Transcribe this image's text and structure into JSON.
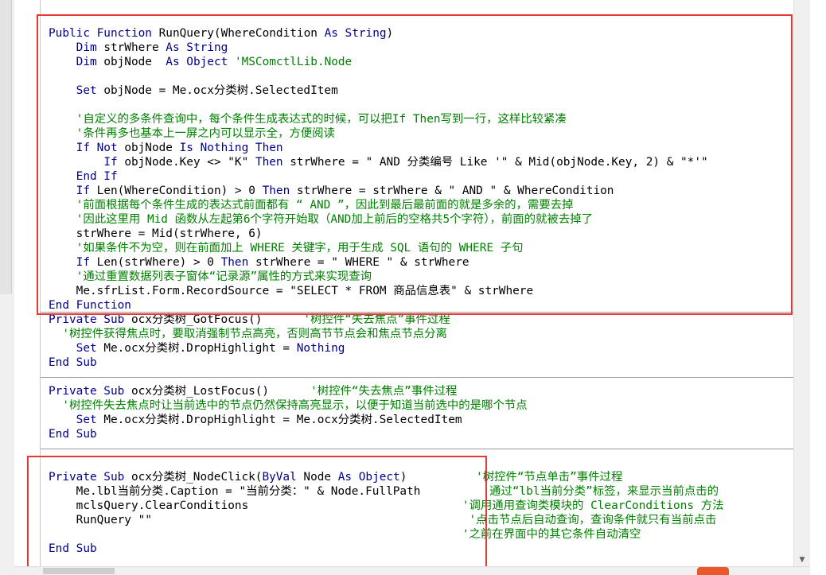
{
  "colors": {
    "keyword": "#00008b",
    "comment": "#008000",
    "plain": "#000000",
    "highlight_box": "#e53935",
    "separator": "#9a9a9a"
  },
  "icons": {
    "scroll_down": "triangle-down",
    "taskbar": "orange-app-icon"
  },
  "procedures": [
    {
      "name": "RunQuery",
      "lines": [
        [
          {
            "t": "k",
            "v": "Public Function "
          },
          {
            "t": "p",
            "v": "RunQuery(WhereCondition "
          },
          {
            "t": "k",
            "v": "As String"
          },
          {
            "t": "p",
            "v": ")"
          }
        ],
        [
          {
            "t": "p",
            "v": "    "
          },
          {
            "t": "k",
            "v": "Dim "
          },
          {
            "t": "p",
            "v": "strWhere "
          },
          {
            "t": "k",
            "v": "As String"
          }
        ],
        [
          {
            "t": "p",
            "v": "    "
          },
          {
            "t": "k",
            "v": "Dim "
          },
          {
            "t": "p",
            "v": "objNode  "
          },
          {
            "t": "k",
            "v": "As Object "
          },
          {
            "t": "c",
            "v": "'MSComctlLib.Node"
          }
        ],
        [],
        [
          {
            "t": "p",
            "v": "    "
          },
          {
            "t": "k",
            "v": "Set "
          },
          {
            "t": "p",
            "v": "objNode = Me.ocx分类树.SelectedItem"
          }
        ],
        [],
        [
          {
            "t": "p",
            "v": "    "
          },
          {
            "t": "c",
            "v": "'自定义的多条件查询中，每个条件生成表达式的时候，可以把If Then写到一行，这样比较紧凑"
          }
        ],
        [
          {
            "t": "p",
            "v": "    "
          },
          {
            "t": "c",
            "v": "'条件再多也基本上一屏之内可以显示全，方便阅读"
          }
        ],
        [
          {
            "t": "p",
            "v": "    "
          },
          {
            "t": "k",
            "v": "If Not "
          },
          {
            "t": "p",
            "v": "objNode "
          },
          {
            "t": "k",
            "v": "Is Nothing Then"
          }
        ],
        [
          {
            "t": "p",
            "v": "        "
          },
          {
            "t": "k",
            "v": "If "
          },
          {
            "t": "p",
            "v": "objNode.Key <> \"K\" "
          },
          {
            "t": "k",
            "v": "Then "
          },
          {
            "t": "p",
            "v": "strWhere = \" AND 分类编号 Like '\" & Mid(objNode.Key, 2) & \"*'\""
          }
        ],
        [
          {
            "t": "p",
            "v": "    "
          },
          {
            "t": "k",
            "v": "End If"
          }
        ],
        [
          {
            "t": "p",
            "v": "    "
          },
          {
            "t": "k",
            "v": "If "
          },
          {
            "t": "p",
            "v": "Len(WhereCondition) > 0 "
          },
          {
            "t": "k",
            "v": "Then "
          },
          {
            "t": "p",
            "v": "strWhere = strWhere & \" AND \" & WhereCondition"
          }
        ],
        [
          {
            "t": "p",
            "v": "    "
          },
          {
            "t": "c",
            "v": "'前面根据每个条件生成的表达式前面都有 “ AND ”，因此到最后最前面的就是多余的，需要去掉"
          }
        ],
        [
          {
            "t": "p",
            "v": "    "
          },
          {
            "t": "c",
            "v": "'因此这里用 Mid 函数从左起第6个字符开始取（AND加上前后的空格共5个字符），前面的就被去掉了"
          }
        ],
        [
          {
            "t": "p",
            "v": "    strWhere = Mid(strWhere, 6)"
          }
        ],
        [
          {
            "t": "p",
            "v": "    "
          },
          {
            "t": "c",
            "v": "'如果条件不为空，则在前面加上 WHERE 关键字，用于生成 SQL 语句的 WHERE 子句"
          }
        ],
        [
          {
            "t": "p",
            "v": "    "
          },
          {
            "t": "k",
            "v": "If "
          },
          {
            "t": "p",
            "v": "Len(strWhere) > 0 "
          },
          {
            "t": "k",
            "v": "Then "
          },
          {
            "t": "p",
            "v": "strWhere = \" WHERE \" & strWhere"
          }
        ],
        [
          {
            "t": "p",
            "v": "    "
          },
          {
            "t": "c",
            "v": "'通过重置数据列表子窗体“记录源”属性的方式来实现查询"
          }
        ],
        [
          {
            "t": "p",
            "v": "    Me.sfrList.Form.RecordSource = \"SELECT * FROM 商品信息表\" & strWhere"
          }
        ],
        [
          {
            "t": "k",
            "v": "End Function"
          }
        ]
      ]
    },
    {
      "name": "ocx分类树_GotFocus",
      "lines": [
        [
          {
            "t": "k",
            "v": "Private Sub "
          },
          {
            "t": "p",
            "v": "ocx分类树_GotFocus()      "
          },
          {
            "t": "c",
            "v": "'树控件“失去焦点”事件过程"
          }
        ],
        [
          {
            "t": "p",
            "v": "  "
          },
          {
            "t": "c",
            "v": "'树控件获得焦点时，要取消强制节点高亮，否则高节节点会和焦点节点分离"
          }
        ],
        [
          {
            "t": "p",
            "v": "    "
          },
          {
            "t": "k",
            "v": "Set "
          },
          {
            "t": "p",
            "v": "Me.ocx分类树.DropHighlight = "
          },
          {
            "t": "k",
            "v": "Nothing"
          }
        ],
        [
          {
            "t": "k",
            "v": "End Sub"
          }
        ]
      ]
    },
    {
      "name": "ocx分类树_LostFocus",
      "lines": [
        [
          {
            "t": "k",
            "v": "Private Sub "
          },
          {
            "t": "p",
            "v": "ocx分类树_LostFocus()      "
          },
          {
            "t": "c",
            "v": "'树控件“失去焦点”事件过程"
          }
        ],
        [
          {
            "t": "p",
            "v": "  "
          },
          {
            "t": "c",
            "v": "'树控件失去焦点时让当前选中的节点仍然保持高亮显示，以便于知道当前选中的是哪个节点"
          }
        ],
        [
          {
            "t": "p",
            "v": "    "
          },
          {
            "t": "k",
            "v": "Set "
          },
          {
            "t": "p",
            "v": "Me.ocx分类树.DropHighlight = Me.ocx分类树.SelectedItem"
          }
        ],
        [
          {
            "t": "k",
            "v": "End Sub"
          }
        ]
      ]
    },
    {
      "name": "ocx分类树_NodeClick",
      "lines": [
        [
          {
            "t": "k",
            "v": "Private Sub "
          },
          {
            "t": "p",
            "v": "ocx分类树_NodeClick("
          },
          {
            "t": "k",
            "v": "ByVal "
          },
          {
            "t": "p",
            "v": "Node "
          },
          {
            "t": "k",
            "v": "As Object"
          },
          {
            "t": "p",
            "v": ")          "
          },
          {
            "t": "c",
            "v": "'树控件“节点单击”事件过程"
          }
        ],
        [
          {
            "t": "p",
            "v": "    Me.lbl当前分类.Caption = \"当前分类：\" & Node.FullPath         "
          },
          {
            "t": "c",
            "v": "'通过“lbl当前分类”标签，来显示当前点击的"
          }
        ],
        [
          {
            "t": "p",
            "v": "    mclsQuery.ClearConditions                               "
          },
          {
            "t": "c",
            "v": "'调用通用查询类模块的 ClearConditions 方法"
          }
        ],
        [
          {
            "t": "p",
            "v": "    RunQuery \"\"                                              "
          },
          {
            "t": "c",
            "v": "'点击节点后自动查询，查询条件就只有当前点击"
          }
        ],
        [
          {
            "t": "p",
            "v": "                                                            "
          },
          {
            "t": "c",
            "v": "'之前在界面中的其它条件自动清空"
          }
        ],
        [
          {
            "t": "k",
            "v": "End Sub"
          }
        ]
      ]
    }
  ]
}
